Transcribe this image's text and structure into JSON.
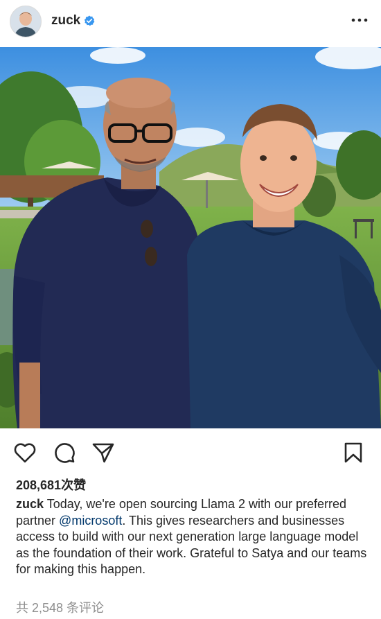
{
  "post": {
    "username": "zuck",
    "verified": true,
    "likes": "208,681次赞",
    "caption_user": "zuck",
    "caption_part1": " Today, we're open sourcing Llama 2 with our preferred partner ",
    "caption_mention": "@microsoft",
    "caption_part2": ". This gives researchers and businesses access to build with our next generation large language model as the foundation of their work. Grateful to Satya and our teams for making this happen.",
    "comments_link": "共 2,548 条评论"
  },
  "icons": {
    "avatar": "avatar",
    "verified": "verified-badge-icon",
    "more": "more-options-icon",
    "like": "heart-icon",
    "comment": "comment-bubble-icon",
    "share": "paper-plane-icon",
    "save": "bookmark-icon"
  },
  "colors": {
    "verified": "#3897f0",
    "mention": "#00376b",
    "muted": "#8e8e8e"
  }
}
